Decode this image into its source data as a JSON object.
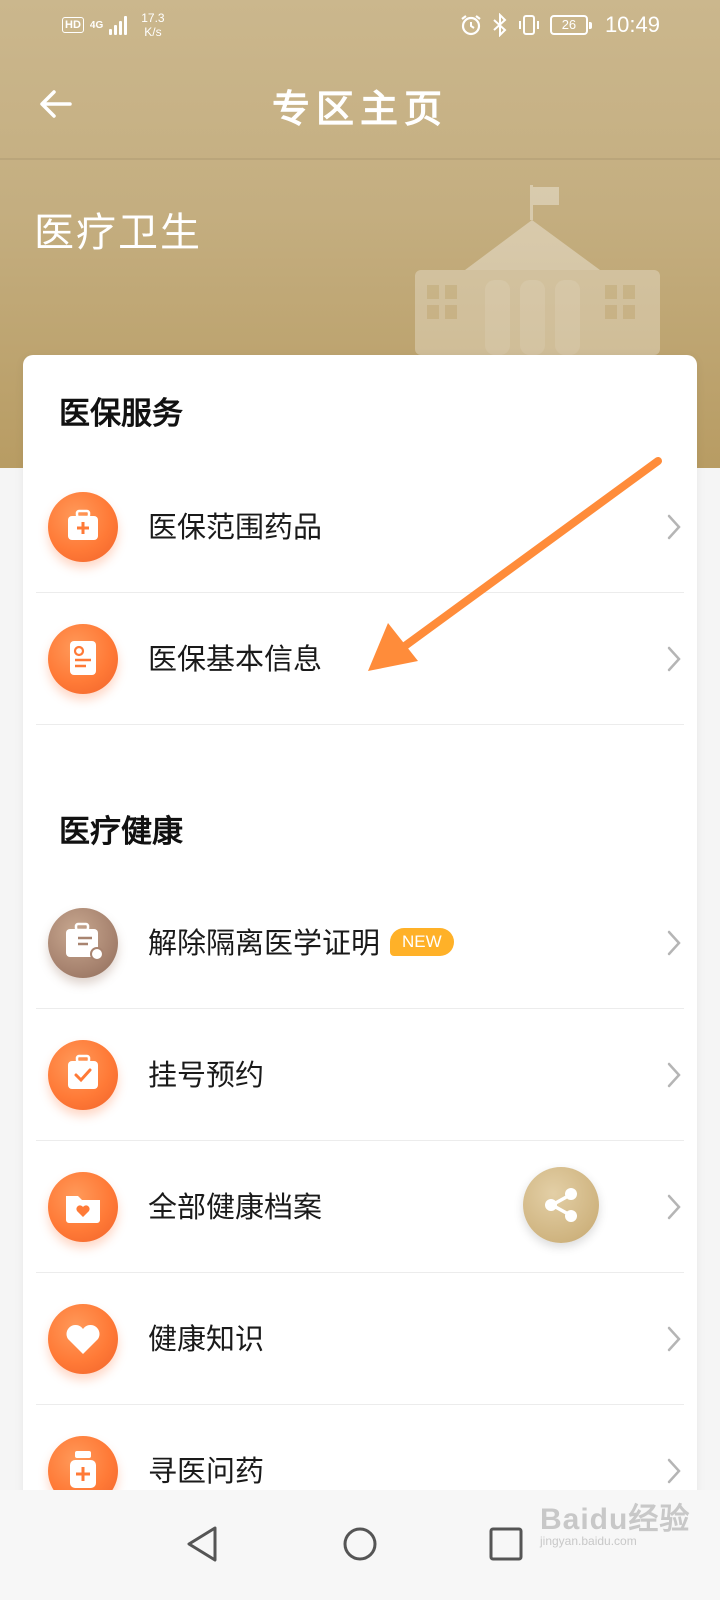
{
  "status_bar": {
    "hd": "HD",
    "network": "4G",
    "speed_value": "17.3",
    "speed_unit": "K/s",
    "battery": "26",
    "time": "10:49"
  },
  "header": {
    "title": "专区主页",
    "zone_title": "医疗卫生"
  },
  "sections": [
    {
      "title": "医保服务",
      "items": [
        {
          "label": "医保范围药品",
          "icon": "medicine-kit-icon"
        },
        {
          "label": "医保基本信息",
          "icon": "insurance-card-icon"
        }
      ]
    },
    {
      "title": "医疗健康",
      "items": [
        {
          "label": "解除隔离医学证明",
          "icon": "isolation-certificate-icon",
          "badge": "NEW"
        },
        {
          "label": "挂号预约",
          "icon": "clipboard-check-icon"
        },
        {
          "label": "全部健康档案",
          "icon": "health-folder-icon"
        },
        {
          "label": "健康知识",
          "icon": "heart-icon"
        },
        {
          "label": "寻医问药",
          "icon": "medicine-bottle-icon"
        }
      ]
    }
  ],
  "colors": {
    "header_gold": "#c4ae80",
    "icon_orange": "#ff7a37",
    "badge_yellow": "#ffb128",
    "annotation_orange": "#ff8c3a"
  },
  "watermark": {
    "main": "Baidu经验",
    "sub": "jingyan.baidu.com"
  }
}
